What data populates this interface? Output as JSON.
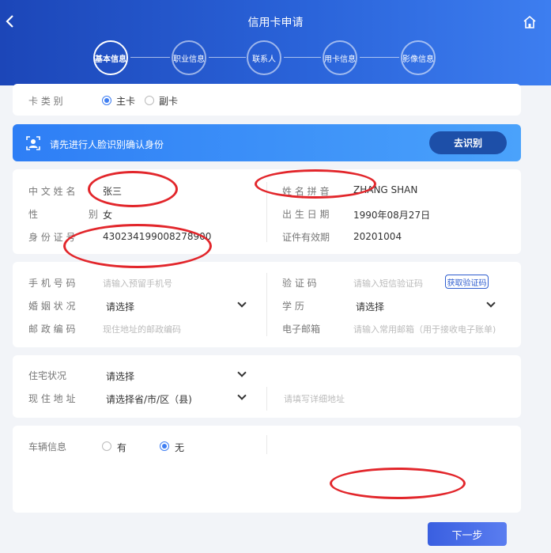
{
  "header": {
    "title": "信用卡申请",
    "back_icon": "chevron-left-icon",
    "home_icon": "home-icon"
  },
  "steps": [
    "基本信息",
    "职业信息",
    "联系人",
    "用卡信息",
    "影像信息"
  ],
  "card_type": {
    "label": "卡 类 别",
    "options": [
      "主卡",
      "副卡"
    ],
    "selected": "主卡"
  },
  "face_banner": {
    "text": "请先进行人脸识别确认身份",
    "button": "去识别"
  },
  "identity": {
    "name_label": "中 文 姓 名",
    "name_value": "张三",
    "pinyin_label": "姓 名 拼 音",
    "pinyin_value": "ZHANG SHAN",
    "gender_label": "性 别",
    "gender_value": "女",
    "birth_label": "出 生 日 期",
    "birth_value": "1990年08月27日",
    "id_label": "身 份 证 号",
    "id_value": "430234199008278900",
    "expiry_label": "证件有效期",
    "expiry_value": "20201004"
  },
  "contact": {
    "phone_label": "手 机 号 码",
    "phone_placeholder": "请输入预留手机号",
    "code_label": "验 证 码",
    "code_placeholder": "请输入短信验证码",
    "code_button": "获取验证码",
    "marital_label": "婚 姻 状 况",
    "marital_value": "请选择",
    "education_label": "学 历",
    "education_value": "请选择",
    "zip_label": "邮 政 编 码",
    "zip_placeholder": "现住地址的邮政编码",
    "email_label": "电子邮箱",
    "email_placeholder": "请输入常用邮箱（用于接收电子账单)"
  },
  "address": {
    "residence_label": "住宅状况",
    "residence_value": "请选择",
    "current_label": "现 住 地 址",
    "current_value": "请选择省/市/区（县)",
    "detail_placeholder": "请填写详细地址"
  },
  "vehicle": {
    "label": "车辆信息",
    "options": [
      "有",
      "无"
    ],
    "selected": "无"
  },
  "next_button": "下一步",
  "colors": {
    "primary": "#2a63d9",
    "accent": "#3f7ef2",
    "annotation": "#e2262b"
  }
}
